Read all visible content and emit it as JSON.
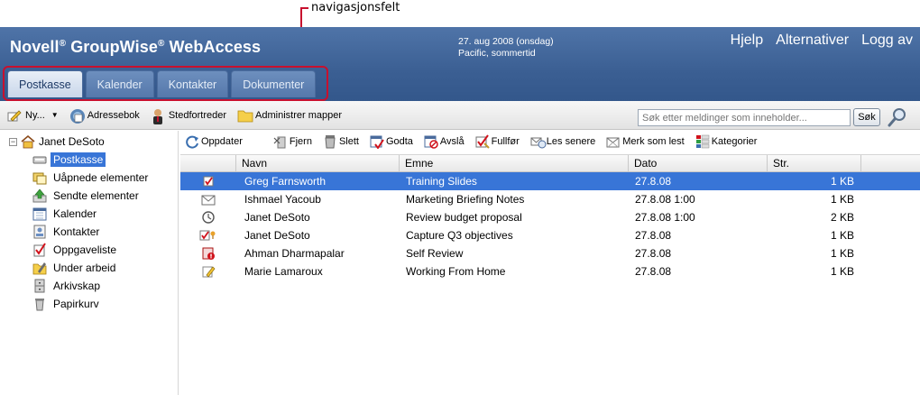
{
  "callout": {
    "label": "navigasjonsfelt"
  },
  "header": {
    "title": "Novell",
    "title_mark": "®",
    "title_part2": " GroupWise",
    "title_mark2": "®",
    "title_part3": " WebAccess",
    "date": "27. aug 2008 (onsdag)",
    "timezone": "Pacific, sommertid",
    "links": {
      "help": "Hjelp",
      "options": "Alternativer",
      "logout": "Logg av"
    }
  },
  "tabs": [
    {
      "label": "Postkasse",
      "active": true
    },
    {
      "label": "Kalender",
      "active": false
    },
    {
      "label": "Kontakter",
      "active": false
    },
    {
      "label": "Dokumenter",
      "active": false
    }
  ],
  "toolbar": {
    "new_label": "Ny...",
    "address_book": "Adressebok",
    "proxy": "Stedfortreder",
    "manage_folders": "Administrer mapper",
    "search_placeholder": "Søk etter meldinger som inneholder...",
    "search_button": "Søk"
  },
  "sidebar": {
    "user": "Janet DeSoto",
    "folders": [
      {
        "label": "Postkasse",
        "icon": "mailbox-icon",
        "selected": true
      },
      {
        "label": "Uåpnede elementer",
        "icon": "unopened-items-icon",
        "selected": false
      },
      {
        "label": "Sendte elementer",
        "icon": "sent-items-icon",
        "selected": false
      },
      {
        "label": "Kalender",
        "icon": "calendar-icon",
        "selected": false
      },
      {
        "label": "Kontakter",
        "icon": "contacts-icon",
        "selected": false
      },
      {
        "label": "Oppgaveliste",
        "icon": "checklist-icon",
        "selected": false
      },
      {
        "label": "Under arbeid",
        "icon": "work-in-progress-icon",
        "selected": false
      },
      {
        "label": "Arkivskap",
        "icon": "cabinet-icon",
        "selected": false
      },
      {
        "label": "Papirkurv",
        "icon": "trash-icon",
        "selected": false
      }
    ]
  },
  "message_toolbar": {
    "refresh": "Oppdater",
    "remove": "Fjern",
    "delete": "Slett",
    "accept": "Godta",
    "decline": "Avslå",
    "complete": "Fullfør",
    "read_later": "Les senere",
    "mark_read": "Merk som lest",
    "categories": "Kategorier"
  },
  "grid": {
    "columns": [
      "Navn",
      "Emne",
      "Dato",
      "Str."
    ],
    "rows": [
      {
        "icon": "task-icon",
        "name": "Greg Farnsworth",
        "subject": "Training Slides",
        "date": "27.8.08",
        "size": "1 KB",
        "selected": true
      },
      {
        "icon": "mail-icon",
        "name": "Ishmael Yacoub",
        "subject": "Marketing Briefing Notes",
        "date": "27.8.08 1:00",
        "size": "1 KB",
        "selected": false
      },
      {
        "icon": "appointment-icon",
        "name": "Janet DeSoto",
        "subject": "Review budget proposal",
        "date": "27.8.08 1:00",
        "size": "2 KB",
        "selected": false
      },
      {
        "icon": "task-posted-icon",
        "name": "Janet DeSoto",
        "subject": "Capture Q3 objectives",
        "date": "27.8.08",
        "size": "1 KB",
        "selected": false
      },
      {
        "icon": "reminder-note-icon",
        "name": "Ahman Dharmapalar",
        "subject": "Self Review",
        "date": "27.8.08",
        "size": "1 KB",
        "selected": false
      },
      {
        "icon": "note-icon",
        "name": "Marie Lamaroux",
        "subject": "Working From Home",
        "date": "27.8.08",
        "size": "1 KB",
        "selected": false
      }
    ]
  }
}
